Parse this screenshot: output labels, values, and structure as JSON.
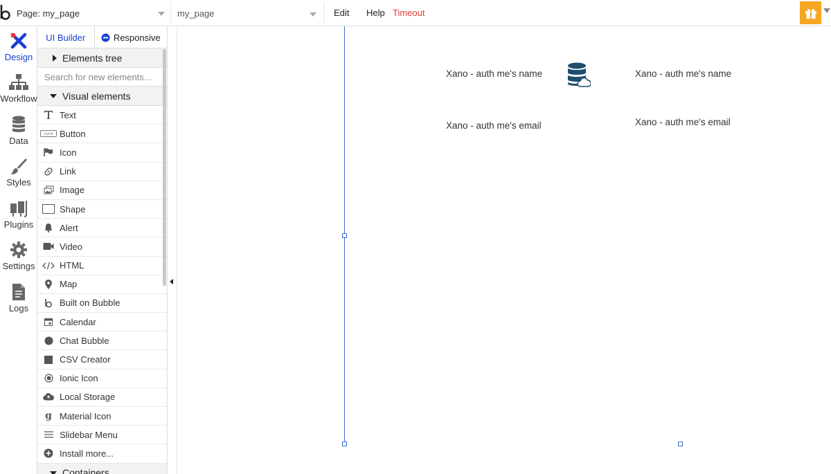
{
  "topbar": {
    "page_select": "Page: my_page",
    "element_select": "my_page",
    "menu": {
      "edit": "Edit",
      "help": "Help",
      "timeout": "Timeout"
    }
  },
  "leftnav": {
    "items": [
      {
        "label": "Design",
        "icon": "design-icon",
        "active": true
      },
      {
        "label": "Workflow",
        "icon": "workflow-icon"
      },
      {
        "label": "Data",
        "icon": "data-icon"
      },
      {
        "label": "Styles",
        "icon": "brush-icon"
      },
      {
        "label": "Plugins",
        "icon": "plugins-icon"
      },
      {
        "label": "Settings",
        "icon": "gear-icon"
      },
      {
        "label": "Logs",
        "icon": "document-icon"
      }
    ]
  },
  "panel": {
    "tab_ui_builder": "UI Builder",
    "tab_responsive": "Responsive",
    "elements_tree": "Elements tree",
    "search_placeholder": "Search for new elements...",
    "visual_elements": "Visual elements",
    "containers": "Containers",
    "elements": [
      {
        "label": "Text",
        "icon": "text-icon"
      },
      {
        "label": "Button",
        "icon": "button-icon"
      },
      {
        "label": "Icon",
        "icon": "flag-icon"
      },
      {
        "label": "Link",
        "icon": "link-icon"
      },
      {
        "label": "Image",
        "icon": "image-icon"
      },
      {
        "label": "Shape",
        "icon": "shape-icon"
      },
      {
        "label": "Alert",
        "icon": "bell-icon"
      },
      {
        "label": "Video",
        "icon": "video-icon"
      },
      {
        "label": "HTML",
        "icon": "code-icon"
      },
      {
        "label": "Map",
        "icon": "map-pin-icon"
      },
      {
        "label": "Built on Bubble",
        "icon": "bubble-logo-icon"
      },
      {
        "label": "Calendar",
        "icon": "calendar-icon"
      },
      {
        "label": "Chat Bubble",
        "icon": "chat-bubble-icon"
      },
      {
        "label": "CSV Creator",
        "icon": "csv-icon"
      },
      {
        "label": "Ionic Icon",
        "icon": "ionic-icon"
      },
      {
        "label": "Local Storage",
        "icon": "cloud-icon"
      },
      {
        "label": "Material Icon",
        "icon": "material-icon"
      },
      {
        "label": "Slidebar Menu",
        "icon": "menu-icon"
      },
      {
        "label": "Install more...",
        "icon": "plus-circle-icon"
      }
    ]
  },
  "canvas": {
    "left_name": "Xano - auth me's name",
    "left_email": "Xano - auth me's email",
    "right_name": "Xano - auth me's name",
    "right_email": "Xano - auth me's email"
  },
  "colors": {
    "accent": "#1a3fd1",
    "selection": "#3b6fd6",
    "timeout": "#e53935",
    "gift": "#f5a623",
    "db_icon": "#1f4e6e"
  }
}
